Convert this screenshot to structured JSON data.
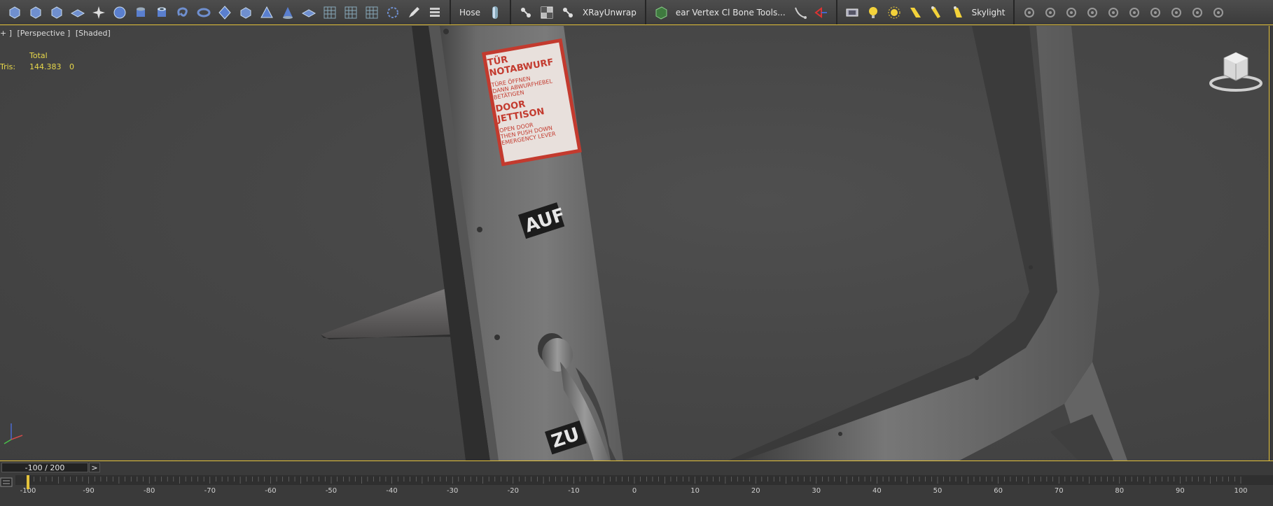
{
  "toolbar": {
    "hose_label": "Hose",
    "xray_label": "XRayUnwrap",
    "vertex_tools_label": "ear Vertex Cl Bone Tools...",
    "skylight_label": "Skylight",
    "icons": [
      "box-icon",
      "box-icon",
      "box-icon",
      "plane-icon",
      "star-icon",
      "sphere-icon",
      "cylinder-icon",
      "tube-icon",
      "torus-knot-icon",
      "torus-icon",
      "geosphere-icon",
      "chamfer-box-icon",
      "pyramid-icon",
      "cone-icon",
      "plane-icon",
      "grid-icon",
      "grid-icon",
      "grid-icon",
      "ring-icon",
      "pen-icon",
      "layers-icon"
    ]
  },
  "viewport": {
    "label_parts": [
      "+ ]",
      "[Perspective ]",
      "[Shaded]"
    ],
    "stats": {
      "header": "Total",
      "tris_label": "Tris:",
      "tris_total": "144.383",
      "tris_selected": "0"
    },
    "decal": {
      "title_de": "TÜR NOTABWURF",
      "line1_de": "TÜRE ÖFFNEN",
      "line2_de": "DANN ABWURFHEBEL",
      "line3_de": "BETÄTIGEN",
      "title_en": "DOOR JETTISON",
      "line1_en": "OPEN DOOR",
      "line2_en": "THEN PUSH DOWN",
      "line3_en": "EMERGENCY LEVER"
    },
    "label_open": "AUF",
    "label_closed": "ZU",
    "colors": {
      "accent": "#e4c23a",
      "stats_text": "#e8d84a",
      "decal_red": "#c33a2e"
    }
  },
  "timeline": {
    "frame_display": "-100 / 200",
    "next_label": ">",
    "start": -100,
    "end": 100,
    "major_step": 10,
    "current_frame": -100
  }
}
